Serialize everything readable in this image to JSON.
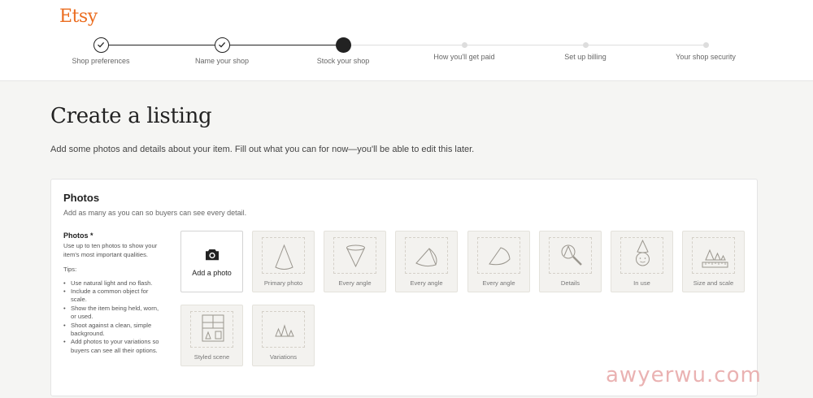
{
  "brand": {
    "logo_text": "Etsy",
    "logo_color": "#eb6d20"
  },
  "progress": {
    "steps": [
      {
        "label": "Shop preferences",
        "state": "done"
      },
      {
        "label": "Name your shop",
        "state": "done"
      },
      {
        "label": "Stock your shop",
        "state": "current"
      },
      {
        "label": "How you'll get paid",
        "state": "todo"
      },
      {
        "label": "Set up billing",
        "state": "todo"
      },
      {
        "label": "Your shop security",
        "state": "todo"
      }
    ]
  },
  "page": {
    "title": "Create a listing",
    "subtitle": "Add some photos and details about your item. Fill out what you can for now—you'll be able to edit this later."
  },
  "photos_section": {
    "title": "Photos",
    "description": "Add as many as you can so buyers can see every detail.",
    "field_label": "Photos *",
    "field_help": "Use up to ten photos to show your item's most important qualities.",
    "tips_title": "Tips:",
    "tips": [
      "Use natural light and no flash.",
      "Include a common object for scale.",
      "Show the item being held, worn, or used.",
      "Shoot against a clean, simple background.",
      "Add photos to your variations so buyers can see all their options."
    ],
    "add_photo_label": "Add a photo",
    "add_photo_icon": "camera-icon",
    "slots": [
      {
        "caption": "Primary photo",
        "icon": "cone-icon"
      },
      {
        "caption": "Every angle",
        "icon": "inverted-cone-icon"
      },
      {
        "caption": "Every angle",
        "icon": "cone-side-icon"
      },
      {
        "caption": "Every angle",
        "icon": "cone-tilted-icon"
      },
      {
        "caption": "Details",
        "icon": "magnifier-cone-icon"
      },
      {
        "caption": "In use",
        "icon": "cone-hat-face-icon"
      },
      {
        "caption": "Size and scale",
        "icon": "ruler-cones-icon"
      },
      {
        "caption": "Styled scene",
        "icon": "window-scene-icon"
      },
      {
        "caption": "Variations",
        "icon": "three-cones-icon"
      }
    ]
  },
  "watermark": {
    "text": "awyerwu.com"
  }
}
